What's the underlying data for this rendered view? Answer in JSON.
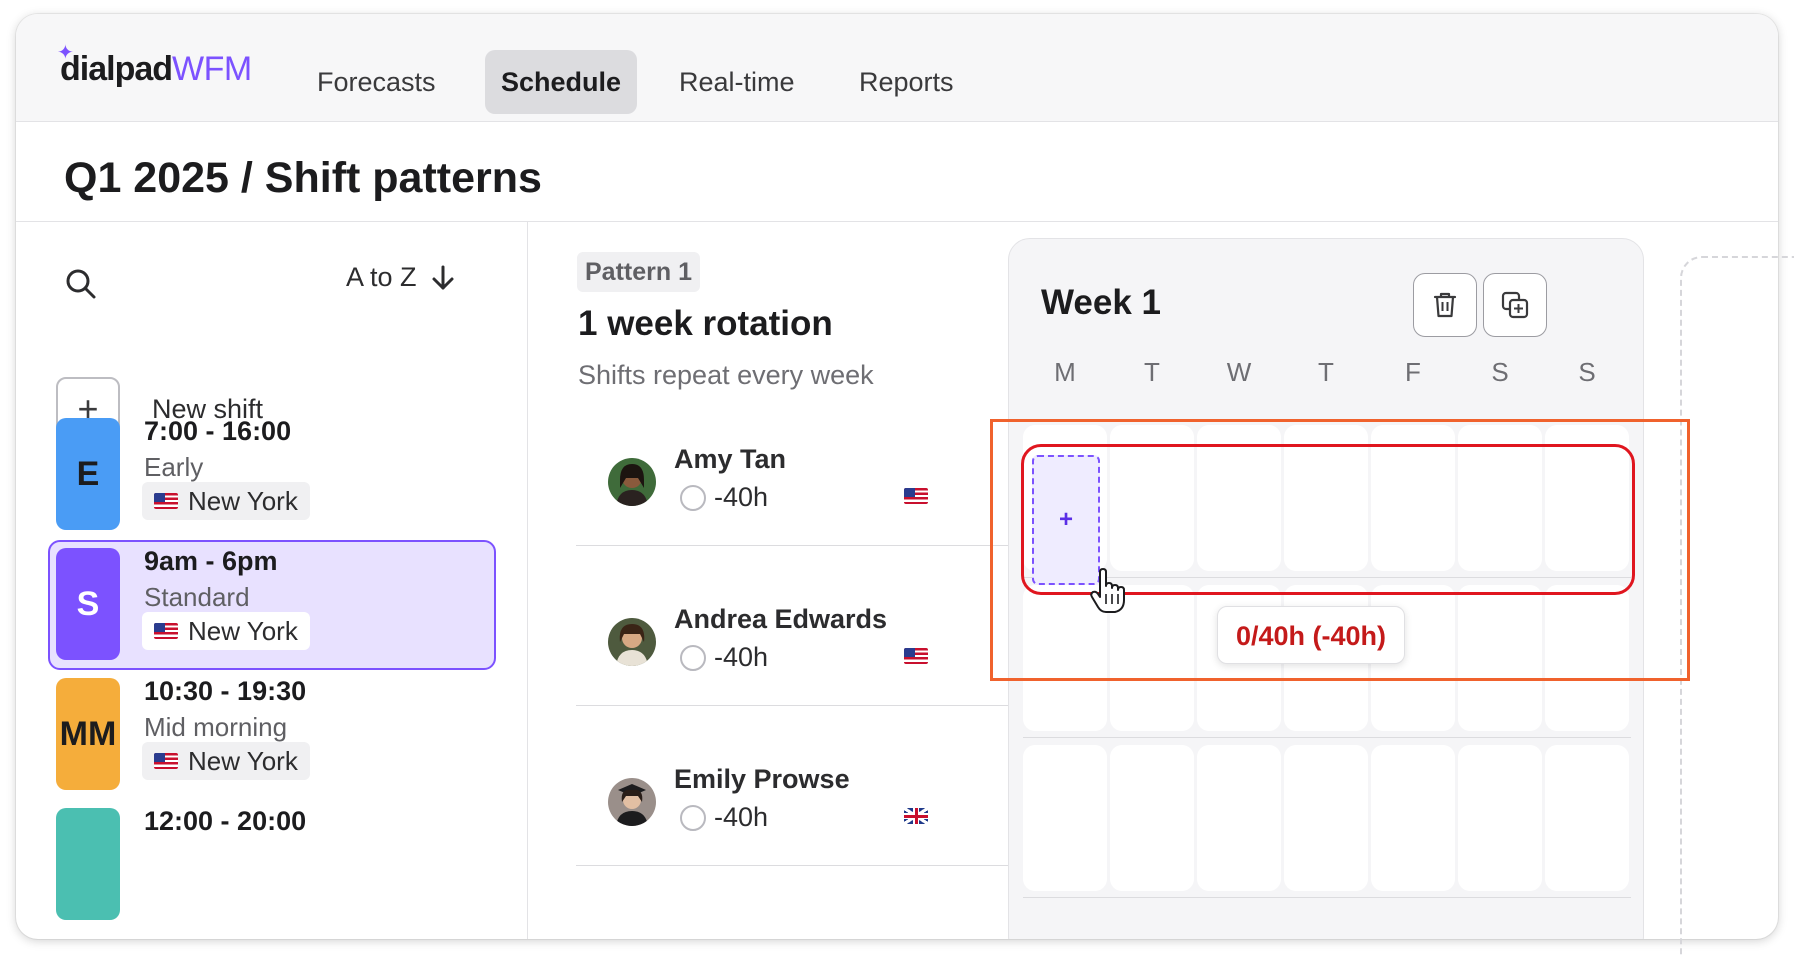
{
  "app": {
    "brand": "dialpad",
    "product": "WFM"
  },
  "nav": {
    "tabs": [
      {
        "label": "Forecasts",
        "active": false
      },
      {
        "label": "Schedule",
        "active": true
      },
      {
        "label": "Real-time",
        "active": false
      },
      {
        "label": "Reports",
        "active": false
      }
    ]
  },
  "page": {
    "title": "Q1 2025 / Shift patterns"
  },
  "sidebar": {
    "sort_label": "A to Z",
    "new_shift_label": "New shift",
    "shifts": [
      {
        "badge": "E",
        "time": "7:00 - 16:00",
        "name": "Early",
        "location": "New York",
        "color": "#4a9cf5",
        "selected": false
      },
      {
        "badge": "S",
        "time": "9am - 6pm",
        "name": "Standard",
        "location": "New York",
        "color": "#7c52ff",
        "selected": true
      },
      {
        "badge": "MM",
        "time": "10:30 - 19:30",
        "name": "Mid morning",
        "location": "New York",
        "color": "#f5ad3b",
        "selected": false
      },
      {
        "badge": "",
        "time": "12:00 - 20:00",
        "name": "",
        "location": "",
        "color": "#4bbfb1",
        "selected": false
      }
    ]
  },
  "pattern": {
    "chip": "Pattern 1",
    "title": "1 week rotation",
    "subtitle": "Shifts repeat every week",
    "agents": [
      {
        "name": "Amy Tan",
        "hours": "-40h",
        "flag": "us-flag-icon"
      },
      {
        "name": "Andrea Edwards",
        "hours": "-40h",
        "flag": "us-flag-icon"
      },
      {
        "name": "Emily Prowse",
        "hours": "-40h",
        "flag": "uk-flag-icon"
      }
    ]
  },
  "week": {
    "title": "Week 1",
    "days": [
      "M",
      "T",
      "W",
      "T",
      "F",
      "S",
      "S"
    ],
    "add_cell_label": "+",
    "tooltip": "0/40h (-40h)"
  },
  "colors": {
    "accent": "#7c52ff",
    "highlight_red": "#e0161f",
    "highlight_orange": "#f0622d",
    "warning_text": "#c41a1a"
  }
}
